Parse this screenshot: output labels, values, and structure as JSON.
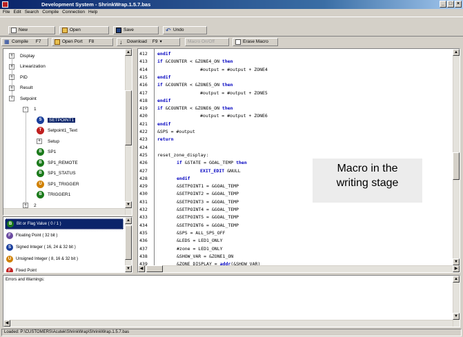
{
  "window": {
    "title": "Development System - ShrinkWrap.1.5.7.bas"
  },
  "menu": [
    "File",
    "Edit",
    "Search",
    "Compile",
    "Connection",
    "Help"
  ],
  "toolbar1": [
    {
      "label": "New"
    },
    {
      "label": "Open"
    },
    {
      "label": "Save"
    },
    {
      "label": "Undo"
    }
  ],
  "toolbar2": [
    {
      "label": "Compile",
      "shortcut": "F7"
    },
    {
      "label": "Open Port",
      "shortcut": "F8"
    },
    {
      "label": "Download",
      "shortcut": "F9"
    },
    {
      "label": "Macro On/Off"
    },
    {
      "label": "Erase Macro"
    }
  ],
  "tree": [
    {
      "label": "Display",
      "level": 0,
      "expander": "+"
    },
    {
      "label": "Linearization",
      "level": 0,
      "expander": "+"
    },
    {
      "label": "PID",
      "level": 0,
      "expander": "+"
    },
    {
      "label": "Result",
      "level": 0,
      "expander": "+"
    },
    {
      "label": "Setpoint",
      "level": 0,
      "expander": "-"
    },
    {
      "label": "1",
      "level": 1,
      "expander": "-"
    },
    {
      "label": "SETPOINT1",
      "level": 2,
      "badge": "S",
      "color": "#1a3f9c",
      "selected": true
    },
    {
      "label": "Setpoint1_Text",
      "level": 2,
      "badge": "T",
      "color": "#c02020"
    },
    {
      "label": "Setup",
      "level": 2,
      "expander": "+"
    },
    {
      "label": "SP1",
      "level": 2,
      "badge": "B",
      "color": "#1b7a1b"
    },
    {
      "label": "SP1_REMOTE",
      "level": 2,
      "badge": "B",
      "color": "#1b7a1b"
    },
    {
      "label": "SP1_STATUS",
      "level": 2,
      "badge": "B",
      "color": "#1b7a1b"
    },
    {
      "label": "SP1_TRIGGER",
      "level": 2,
      "badge": "U",
      "color": "#d08000"
    },
    {
      "label": "TRIGGER1",
      "level": 2,
      "badge": "B",
      "color": "#1b7a1b"
    },
    {
      "label": "2",
      "level": 1,
      "expander": "+"
    }
  ],
  "types": [
    {
      "label": "Bit or Flag Value ( 0 / 1 )",
      "badge": "B",
      "color": "#1b7a1b",
      "selected": true
    },
    {
      "label": "Floating Point ( 32 bit )",
      "badge": "F",
      "color": "#6a4aa0"
    },
    {
      "label": "Signed Integer ( 16, 24 & 32 bit )",
      "badge": "S",
      "color": "#1a3f9c"
    },
    {
      "label": "Unsigned Integer ( 8, 16 & 32 bit )",
      "badge": "U",
      "color": "#d08000"
    },
    {
      "label": "Fixed Point",
      "badge": "F",
      "color": "#c02020"
    }
  ],
  "editor": {
    "lines": [
      {
        "n": "412",
        "indent": 0,
        "parts": [
          {
            "t": "endif",
            "k": 1
          }
        ]
      },
      {
        "n": "413",
        "indent": 0,
        "parts": [
          {
            "t": "if",
            "k": 1
          },
          {
            "t": " &COUNTER < &ZONE4_ON "
          },
          {
            "t": "then",
            "k": 1
          }
        ]
      },
      {
        "n": "414",
        "indent": 2,
        "parts": [
          {
            "t": "#output = #output + ZONE4"
          }
        ]
      },
      {
        "n": "415",
        "indent": 0,
        "parts": [
          {
            "t": "endif",
            "k": 1
          }
        ]
      },
      {
        "n": "416",
        "indent": 0,
        "parts": [
          {
            "t": "if",
            "k": 1
          },
          {
            "t": " &COUNTER < &ZONE5_ON "
          },
          {
            "t": "then",
            "k": 1
          }
        ]
      },
      {
        "n": "417",
        "indent": 2,
        "parts": [
          {
            "t": "#output = #output + ZONE5"
          }
        ]
      },
      {
        "n": "418",
        "indent": 0,
        "parts": [
          {
            "t": "endif",
            "k": 1
          }
        ]
      },
      {
        "n": "419",
        "indent": 0,
        "parts": [
          {
            "t": "if",
            "k": 1
          },
          {
            "t": " &COUNTER < &ZONE6_ON "
          },
          {
            "t": "then",
            "k": 1
          }
        ]
      },
      {
        "n": "420",
        "indent": 2,
        "parts": [
          {
            "t": "#output = #output + ZONE6"
          }
        ]
      },
      {
        "n": "421",
        "indent": 0,
        "parts": [
          {
            "t": "endif",
            "k": 1
          }
        ]
      },
      {
        "n": "422",
        "indent": 0,
        "parts": [
          {
            "t": "&SPS = #output"
          }
        ]
      },
      {
        "n": "423",
        "indent": 0,
        "parts": [
          {
            "t": "return",
            "k": 1
          }
        ]
      },
      {
        "n": "424",
        "indent": 0,
        "parts": [
          {
            "t": ""
          }
        ]
      },
      {
        "n": "425",
        "indent": 0,
        "parts": [
          {
            "t": "reset_zone_display:"
          }
        ]
      },
      {
        "n": "426",
        "indent": 1,
        "parts": [
          {
            "t": "if",
            "k": 1
          },
          {
            "t": " &STATE = GOAL_TEMP "
          },
          {
            "t": "then",
            "k": 1
          }
        ]
      },
      {
        "n": "427",
        "indent": 2,
        "parts": [
          {
            "t": "EXIT_EDIT",
            "k": 1
          },
          {
            "t": " &NULL"
          }
        ]
      },
      {
        "n": "428",
        "indent": 1,
        "parts": [
          {
            "t": "endif",
            "k": 1
          }
        ]
      },
      {
        "n": "429",
        "indent": 1,
        "parts": [
          {
            "t": "&SETPOINT1 = &GOAL_TEMP"
          }
        ]
      },
      {
        "n": "430",
        "indent": 1,
        "parts": [
          {
            "t": "&SETPOINT2 = &GOAL_TEMP"
          }
        ]
      },
      {
        "n": "431",
        "indent": 1,
        "parts": [
          {
            "t": "&SETPOINT3 = &GOAL_TEMP"
          }
        ]
      },
      {
        "n": "432",
        "indent": 1,
        "parts": [
          {
            "t": "&SETPOINT4 = &GOAL_TEMP"
          }
        ]
      },
      {
        "n": "433",
        "indent": 1,
        "parts": [
          {
            "t": "&SETPOINT5 = &GOAL_TEMP"
          }
        ]
      },
      {
        "n": "434",
        "indent": 1,
        "parts": [
          {
            "t": "&SETPOINT6 = &GOAL_TEMP"
          }
        ]
      },
      {
        "n": "435",
        "indent": 1,
        "parts": [
          {
            "t": "&SPS = ALL_SPS_OFF"
          }
        ]
      },
      {
        "n": "436",
        "indent": 1,
        "parts": [
          {
            "t": "&LEDS = LED1_ONLY"
          }
        ]
      },
      {
        "n": "437",
        "indent": 1,
        "parts": [
          {
            "t": "#zone = LED1_ONLY"
          }
        ]
      },
      {
        "n": "438",
        "indent": 1,
        "parts": [
          {
            "t": "&SHOW_VAR = &ZONE1_ON"
          }
        ]
      },
      {
        "n": "439",
        "indent": 1,
        "parts": [
          {
            "t": "&ZONE_DISPLAY = "
          },
          {
            "t": "addr",
            "k": 1
          },
          {
            "t": "(&SHOW_VAR)"
          }
        ]
      }
    ]
  },
  "callout": {
    "line1": "Macro in the",
    "line2": "writing stage"
  },
  "errors": {
    "title": "Errors and Warnings:"
  },
  "status": {
    "text": "Loaded: P:\\CUSTOMERS\\Acutek\\ShrinkWrap\\ShrinkWrap.1.5.7.bas"
  }
}
